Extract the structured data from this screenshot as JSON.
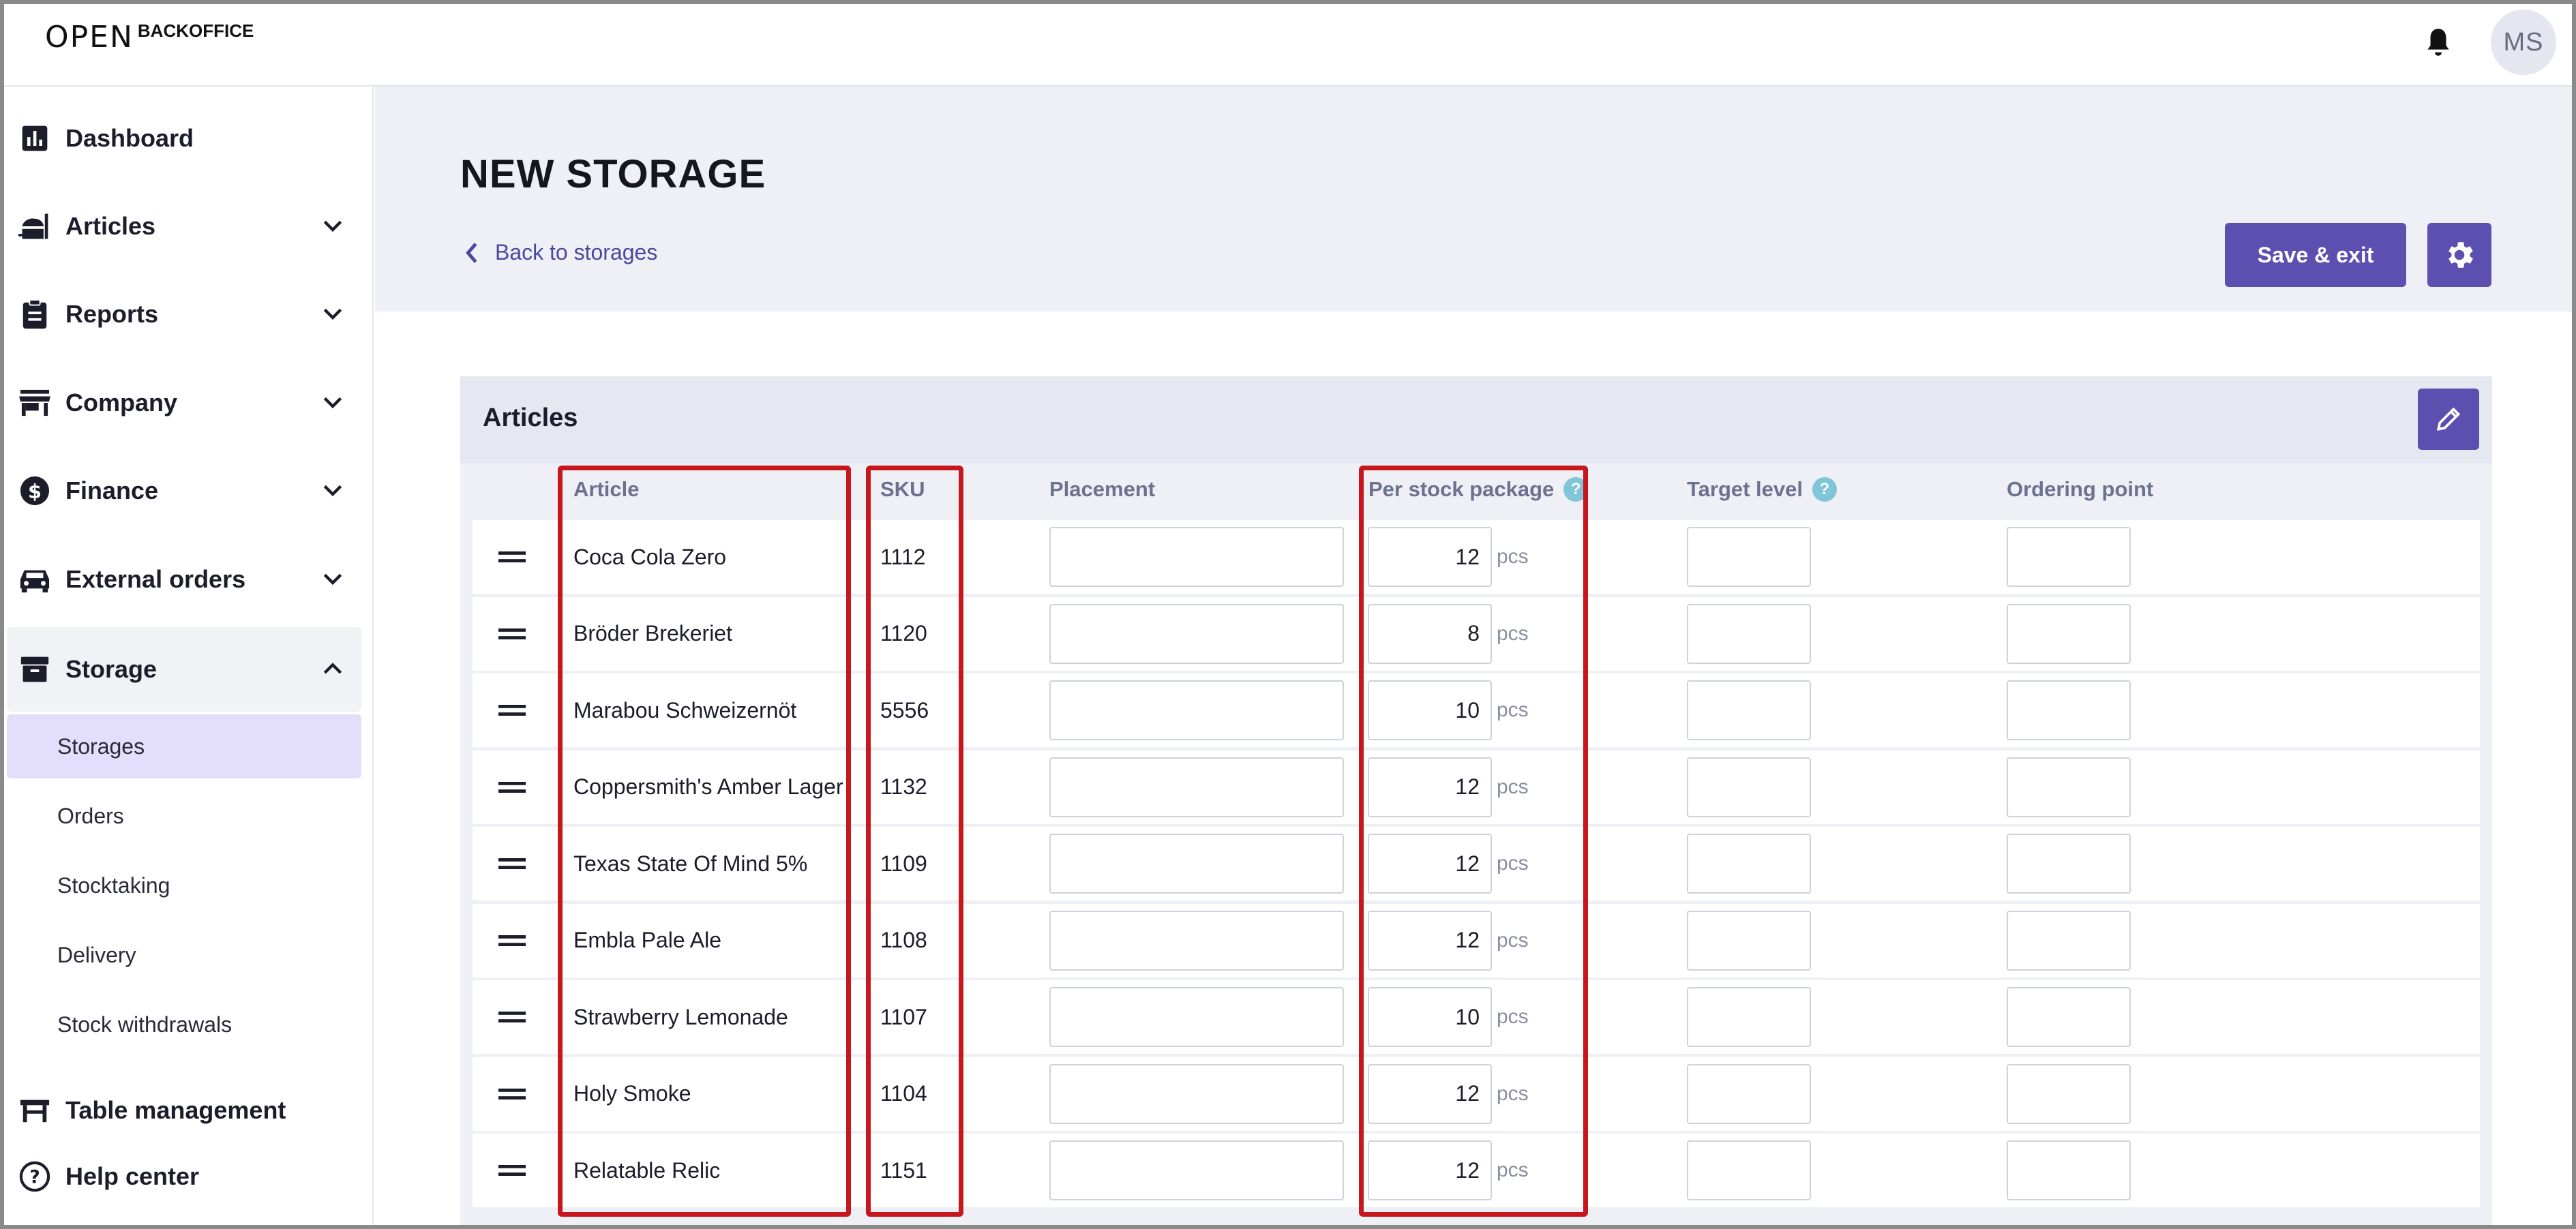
{
  "brand": {
    "logo_mark": "OPEN",
    "logo_text": "BACKOFFICE"
  },
  "user": {
    "initials": "MS"
  },
  "sidebar": {
    "items": [
      {
        "label": "Dashboard",
        "icon": "chart-bar-icon",
        "expandable": false
      },
      {
        "label": "Articles",
        "icon": "food-icon",
        "expandable": true
      },
      {
        "label": "Reports",
        "icon": "clipboard-icon",
        "expandable": true
      },
      {
        "label": "Company",
        "icon": "store-icon",
        "expandable": true
      },
      {
        "label": "Finance",
        "icon": "dollar-circle-icon",
        "expandable": true
      },
      {
        "label": "External orders",
        "icon": "car-icon",
        "expandable": true
      },
      {
        "label": "Storage",
        "icon": "archive-box-icon",
        "expandable": true,
        "open": true
      }
    ],
    "storage_sub": [
      "Storages",
      "Orders",
      "Stocktaking",
      "Delivery",
      "Stock withdrawals"
    ],
    "storage_active": "Storages",
    "bottom": [
      {
        "label": "Table management",
        "icon": "table-icon"
      },
      {
        "label": "Help center",
        "icon": "help-circle-icon"
      }
    ]
  },
  "page": {
    "title": "NEW STORAGE",
    "back_link": "Back to storages",
    "save_label": "Save & exit"
  },
  "articles_panel": {
    "title": "Articles",
    "columns": {
      "article": "Article",
      "sku": "SKU",
      "placement": "Placement",
      "per_stock_package": "Per stock package",
      "target_level": "Target level",
      "ordering_point": "Ordering point"
    },
    "unit": "pcs",
    "help_badge": "?",
    "rows": [
      {
        "article": "Coca Cola Zero",
        "sku": "1112",
        "per_package": "12"
      },
      {
        "article": "Bröder Brekeriet",
        "sku": "1120",
        "per_package": "8"
      },
      {
        "article": "Marabou Schweizernöt",
        "sku": "5556",
        "per_package": "10"
      },
      {
        "article": "Coppersmith's Amber Lager",
        "sku": "1132",
        "per_package": "12"
      },
      {
        "article": "Texas State Of Mind 5%",
        "sku": "1109",
        "per_package": "12"
      },
      {
        "article": "Embla Pale Ale",
        "sku": "1108",
        "per_package": "12"
      },
      {
        "article": "Strawberry Lemonade",
        "sku": "1107",
        "per_package": "10"
      },
      {
        "article": "Holy Smoke",
        "sku": "1104",
        "per_package": "12"
      },
      {
        "article": "Relatable Relic",
        "sku": "1151",
        "per_package": "12"
      }
    ]
  },
  "colors": {
    "accent": "#5b4fb0",
    "active_nav": "#e3defb",
    "highlight": "#c8161d",
    "help_badge": "#7fc6d8"
  }
}
